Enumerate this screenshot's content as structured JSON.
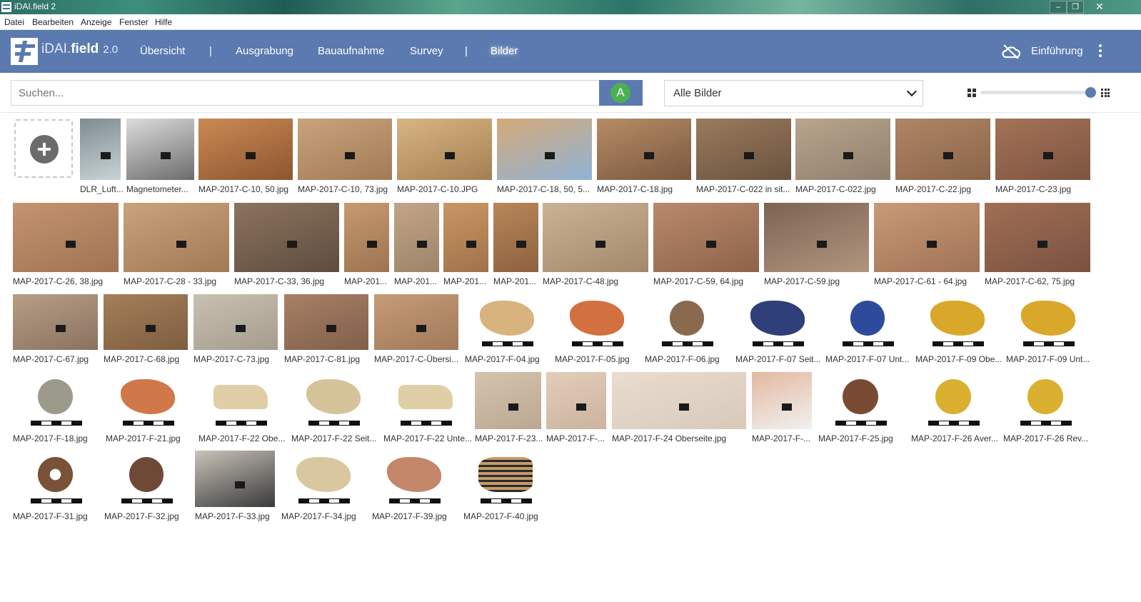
{
  "window": {
    "title": "iDAI.field 2"
  },
  "menu": [
    "Datei",
    "Bearbeiten",
    "Anzeige",
    "Fenster",
    "Hilfe"
  ],
  "navbar": {
    "brand_thin": "iDAI.",
    "brand_bold": "field",
    "version": "2.0",
    "items": [
      "Übersicht",
      "|",
      "Ausgrabung",
      "Bauaufnahme",
      "Survey",
      "|",
      "Bilder"
    ],
    "help": "Einführung"
  },
  "toolbar": {
    "search_placeholder": "Suchen...",
    "search_filter_letter": "A",
    "filter_selected": "Alle Bilder"
  },
  "images": {
    "row1": [
      "DLR_Luft...",
      "Magnetometer...",
      "MAP-2017-C-10, 50.jpg",
      "MAP-2017-C-10, 73.jpg",
      "MAP-2017-C-10.JPG",
      "MAP-2017-C-18, 50, 5...",
      "MAP-2017-C-18.jpg",
      "MAP-2017-C-022 in sit...",
      "MAP-2017-C-022.jpg",
      "MAP-2017-C-22.jpg",
      "MAP-2017-C-23.jpg"
    ],
    "row2": [
      "MAP-2017-C-26, 38.jpg",
      "MAP-2017-C-28 - 33.jpg",
      "MAP-2017-C-33, 36.jpg",
      "MAP-201...",
      "MAP-201...",
      "MAP-201...",
      "MAP-201...",
      "MAP-2017-C-48.jpg",
      "MAP-2017-C-59, 64.jpg",
      "MAP-2017-C-59.jpg",
      "MAP-2017-C-61 - 64.jpg",
      "MAP-2017-C-62, 75.jpg"
    ],
    "row3": [
      "MAP-2017-C-67.jpg",
      "MAP-2017-C-68.jpg",
      "MAP-2017-C-73.jpg",
      "MAP-2017-C-81.jpg",
      "MAP-2017-C-Übersi...",
      "MAP-2017-F-04.jpg",
      "MAP-2017-F-05.jpg",
      "MAP-2017-F-06.jpg",
      "MAP-2017-F-07 Seit...",
      "MAP-2017-F-07 Unt...",
      "MAP-2017-F-09 Obe...",
      "MAP-2017-F-09 Unt..."
    ],
    "row4": [
      "MAP-2017-F-18.jpg",
      "MAP-2017-F-21.jpg",
      "MAP-2017-F-22 Obe...",
      "MAP-2017-F-22 Seit...",
      "MAP-2017-F-22 Unte...",
      "MAP-2017-F-23...",
      "MAP-2017-F-...",
      "MAP-2017-F-24 Oberseite.jpg",
      "MAP-2017-F-...",
      "MAP-2017-F-25.jpg",
      "MAP-2017-F-26 Aver...",
      "MAP-2017-F-26 Rev..."
    ],
    "row5": [
      "MAP-2017-F-31.jpg",
      "MAP-2017-F-32.jpg",
      "MAP-2017-F-33.jpg",
      "MAP-2017-F-34.jpg",
      "MAP-2017-F-39.jpg",
      "MAP-2017-F-40.jpg"
    ]
  },
  "colors": {
    "navbar": "#5a7ab0",
    "accent_green": "#4caf50"
  }
}
